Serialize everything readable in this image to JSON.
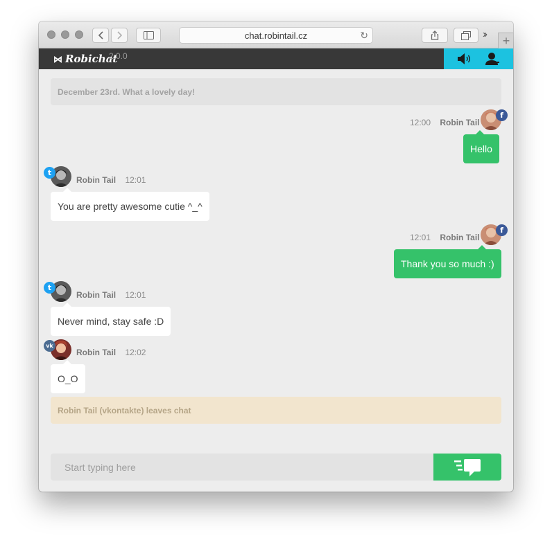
{
  "browser": {
    "url": "chat.robintail.cz"
  },
  "app": {
    "name": "Robichat",
    "version": "2.0.0",
    "accent": "#1cc2e0",
    "bubble_color": "#35c26a"
  },
  "chat": {
    "date_banner": "December 23rd. What a lovely day!",
    "messages": [
      {
        "time": "12:00",
        "author": "Robin Tail",
        "text": "Hello",
        "network": "facebook"
      },
      {
        "time": "12:01",
        "author": "Robin Tail",
        "text": "You are pretty awesome cutie ^_^",
        "network": "twitter"
      },
      {
        "time": "12:01",
        "author": "Robin Tail",
        "text": "Thank you so much :)",
        "network": "facebook"
      },
      {
        "time": "12:01",
        "author": "Robin Tail",
        "text": "Never mind, stay safe :D",
        "network": "twitter"
      },
      {
        "time": "12:02",
        "author": "Robin Tail",
        "text": "O_O",
        "network": "vkontakte"
      }
    ],
    "leave_notice": "Robin Tail (vkontakte) leaves chat"
  },
  "composer": {
    "placeholder": "Start typing here"
  },
  "icons": {
    "sound": "speaker-icon",
    "user": "user-icon",
    "send": "send-message-icon"
  }
}
